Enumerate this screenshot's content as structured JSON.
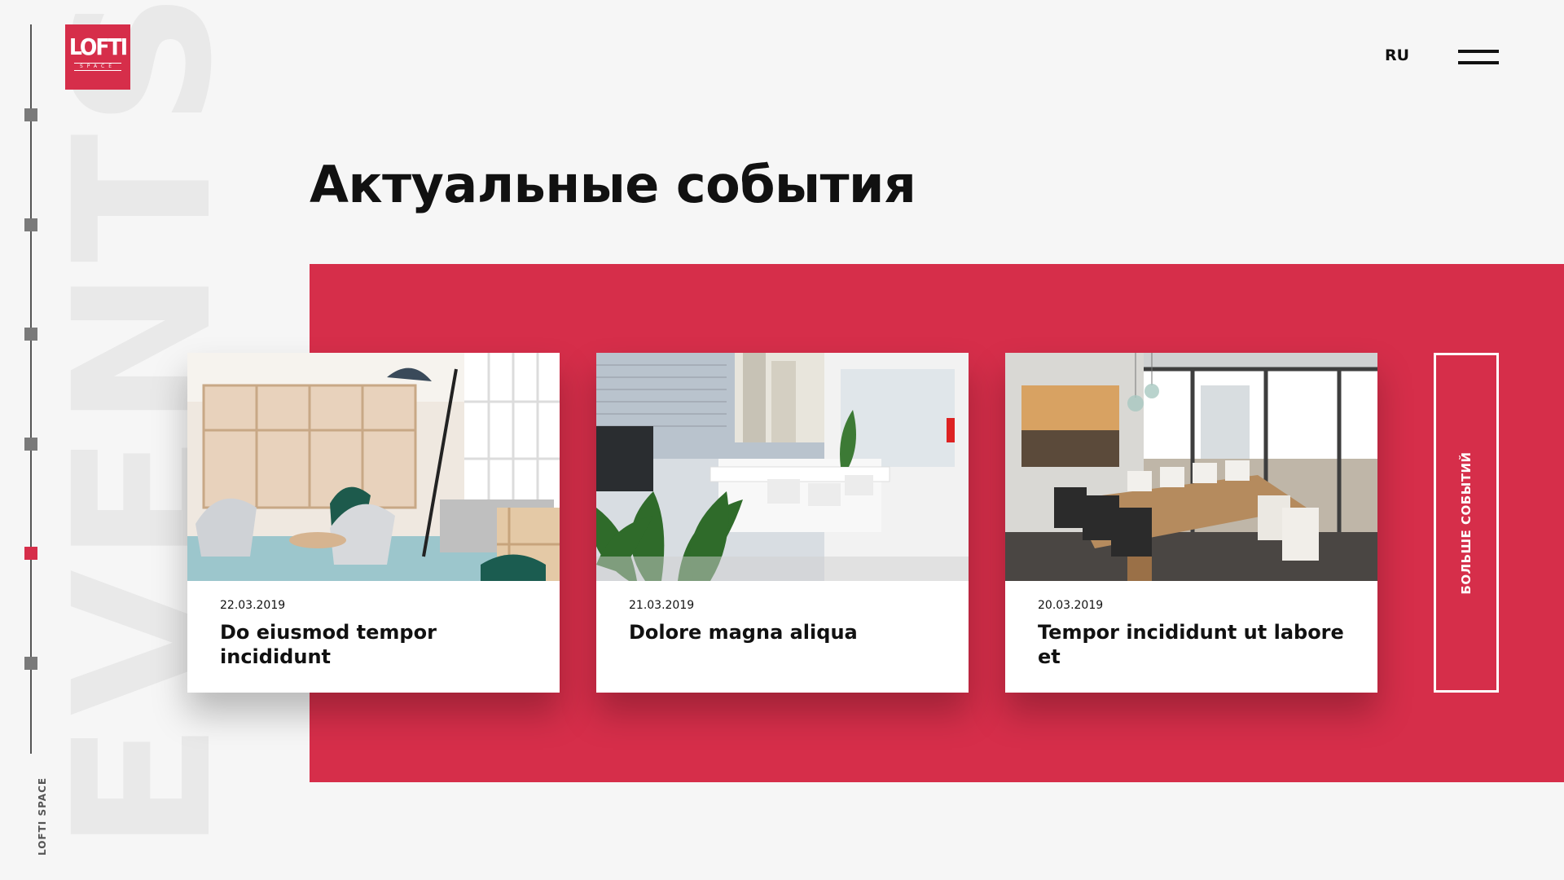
{
  "logo": {
    "main": "LOFTI",
    "sub": "SPACE"
  },
  "background_word": "EVENTS",
  "side_brand": "LOFTI SPACE",
  "header": {
    "language": "RU"
  },
  "page": {
    "title": "Актуальные события"
  },
  "events": [
    {
      "date": "22.03.2019",
      "title": "Do eiusmod tempor incididunt"
    },
    {
      "date": "21.03.2019",
      "title": "Dolore magna aliqua"
    },
    {
      "date": "20.03.2019",
      "title": "Tempor incididunt ut labore et"
    }
  ],
  "more_button": {
    "label": "БОЛЬШЕ СОБЫТИЙ"
  },
  "colors": {
    "accent": "#d62e4a",
    "background": "#f6f6f6",
    "text": "#111111"
  }
}
